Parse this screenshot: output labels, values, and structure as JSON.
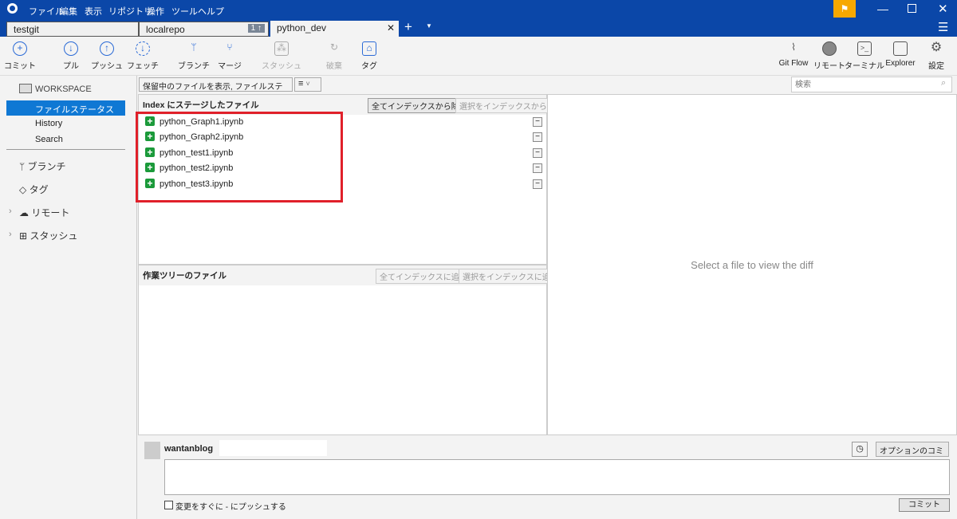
{
  "titlebar": {
    "menu": [
      "ファイル",
      "編集",
      "表示",
      "リポジトリ",
      "操作",
      "ツール",
      "ヘルプ"
    ]
  },
  "tabs": [
    {
      "label": "testgit"
    },
    {
      "label": "localrepo",
      "badge": "1 ↑"
    },
    {
      "label": "python_dev",
      "active": true
    }
  ],
  "toolbar": {
    "left": [
      {
        "label": "コミット",
        "icon": "plus-circle"
      },
      {
        "label": "プル",
        "icon": "arrow-down-circle"
      },
      {
        "label": "プッシュ",
        "icon": "arrow-up-circle"
      },
      {
        "label": "フェッチ",
        "icon": "fetch-circle"
      },
      {
        "label": "ブランチ",
        "icon": "branch"
      },
      {
        "label": "マージ",
        "icon": "merge"
      },
      {
        "label": "スタッシュ",
        "icon": "stash",
        "disabled": true
      },
      {
        "label": "破棄",
        "icon": "discard",
        "disabled": true
      },
      {
        "label": "タグ",
        "icon": "tag"
      }
    ],
    "right": [
      {
        "label": "Git Flow",
        "icon": "git-flow"
      },
      {
        "label": "リモート",
        "icon": "globe"
      },
      {
        "label": "ターミナル",
        "icon": "terminal"
      },
      {
        "label": "Explorer",
        "icon": "folder"
      },
      {
        "label": "設定",
        "icon": "gear"
      }
    ]
  },
  "sidebar": {
    "workspace": "WORKSPACE",
    "items": [
      "ファイルステータス",
      "History",
      "Search"
    ],
    "sections": [
      "ブランチ",
      "タグ",
      "リモート",
      "スタッシュ"
    ]
  },
  "filter": {
    "view": "保留中のファイルを表示, ファイルステータス順",
    "search_placeholder": "検索"
  },
  "staged": {
    "title": "Index にステージしたファイル",
    "unstage_all": "全てインデックスから除く",
    "unstage_selected": "選択をインデックスから除く",
    "files": [
      "python_Graph1.ipynb",
      "python_Graph2.ipynb",
      "python_test1.ipynb",
      "python_test2.ipynb",
      "python_test3.ipynb"
    ]
  },
  "working": {
    "title": "作業ツリーのファイル",
    "add_all": "全てインデックスに追加",
    "add_selected": "選択をインデックスに追加"
  },
  "diff": {
    "placeholder": "Select a file to view the diff"
  },
  "commit": {
    "author": "wantanblog",
    "push_label": "変更をすぐに - にプッシュする",
    "options": "オプションのコミット",
    "commit_button": "コミット"
  },
  "colors": {
    "titlebar": "#0b47a8",
    "accent": "#0f78d4",
    "highlight_box": "#e0202a",
    "added": "#1b9a3a",
    "flag": "#f7a800"
  }
}
